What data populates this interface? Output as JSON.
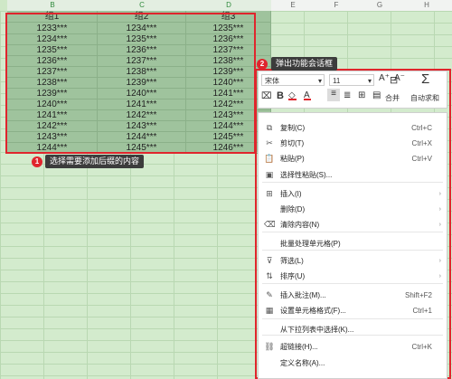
{
  "columns": [
    "B",
    "C",
    "D",
    "E",
    "F",
    "G",
    "H"
  ],
  "headers": [
    "组1",
    "组2",
    "组3"
  ],
  "rows": [
    [
      "1233***",
      "1234***",
      "1235***"
    ],
    [
      "1234***",
      "1235***",
      "1236***"
    ],
    [
      "1235***",
      "1236***",
      "1237***"
    ],
    [
      "1236***",
      "1237***",
      "1238***"
    ],
    [
      "1237***",
      "1238***",
      "1239***"
    ],
    [
      "1238***",
      "1239***",
      "1240***"
    ],
    [
      "1239***",
      "1240***",
      "1241***"
    ],
    [
      "1240***",
      "1241***",
      "1242***"
    ],
    [
      "1241***",
      "1242***",
      "1243***"
    ],
    [
      "1242***",
      "1243***",
      "1244***"
    ],
    [
      "1243***",
      "1244***",
      "1245***"
    ],
    [
      "1244***",
      "1245***",
      "1246***"
    ]
  ],
  "callouts": {
    "step1_num": "1",
    "step1_text": "选择需要添加后缀的内容",
    "step2_num": "2",
    "step2_text": "弹出功能会话框"
  },
  "toolbar": {
    "font_name": "宋体",
    "font_size": "11",
    "grow": "A⁺",
    "shrink": "A⁻",
    "bold": "B",
    "merge_label": "合并",
    "sum_label": "自动求和"
  },
  "menu": {
    "items": [
      {
        "label": "复制(C)",
        "shortcut": "Ctrl+C",
        "icon": "copy-icon",
        "glyph": "⧉"
      },
      {
        "label": "剪切(T)",
        "shortcut": "Ctrl+X",
        "icon": "cut-icon",
        "glyph": "✂"
      },
      {
        "label": "粘贴(P)",
        "shortcut": "Ctrl+V",
        "icon": "paste-icon",
        "glyph": "📋"
      },
      {
        "label": "选择性粘贴(S)...",
        "shortcut": "",
        "icon": "paste-special-icon",
        "glyph": "▣"
      },
      {
        "label": "插入(I)",
        "shortcut": "",
        "icon": "insert-icon",
        "glyph": "⊞",
        "arrow": true
      },
      {
        "label": "删除(D)",
        "shortcut": "",
        "icon": "",
        "glyph": "",
        "arrow": true
      },
      {
        "label": "清除内容(N)",
        "shortcut": "",
        "icon": "clear-icon",
        "glyph": "⌫",
        "arrow": true
      },
      {
        "label": "批量处理单元格(P)",
        "shortcut": "",
        "icon": "",
        "glyph": ""
      },
      {
        "label": "筛选(L)",
        "shortcut": "",
        "icon": "filter-icon",
        "glyph": "⊽",
        "arrow": true
      },
      {
        "label": "排序(U)",
        "shortcut": "",
        "icon": "sort-icon",
        "glyph": "⇅",
        "arrow": true
      },
      {
        "label": "插入批注(M)...",
        "shortcut": "Shift+F2",
        "icon": "comment-icon",
        "glyph": "✎"
      },
      {
        "label": "设置单元格格式(F)...",
        "shortcut": "Ctrl+1",
        "icon": "format-icon",
        "glyph": "▦"
      },
      {
        "label": "从下拉列表中选择(K)...",
        "shortcut": "",
        "icon": "",
        "glyph": ""
      },
      {
        "label": "超链接(H)...",
        "shortcut": "Ctrl+K",
        "icon": "link-icon",
        "glyph": "⛓"
      },
      {
        "label": "定义名称(A)...",
        "shortcut": "",
        "icon": "",
        "glyph": ""
      }
    ]
  },
  "colors": {
    "accent": "#e0252d",
    "selection": "#9fc39d",
    "sheet": "#d3ebcd"
  }
}
